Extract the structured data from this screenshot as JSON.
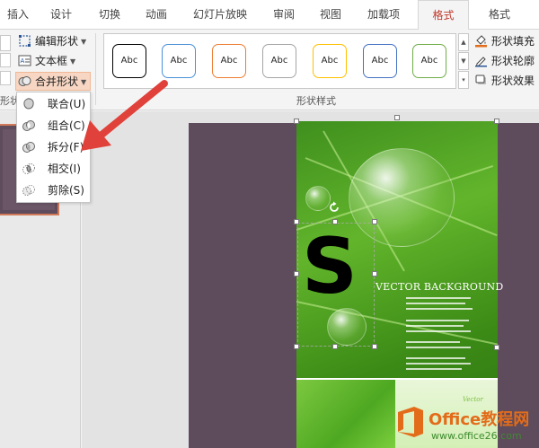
{
  "tabs": [
    {
      "label": "插入"
    },
    {
      "label": "设计"
    },
    {
      "label": "切换"
    },
    {
      "label": "动画"
    },
    {
      "label": "幻灯片放映"
    },
    {
      "label": "审阅"
    },
    {
      "label": "视图"
    },
    {
      "label": "加载项"
    },
    {
      "label": "格式",
      "active": true
    },
    {
      "label": "格式"
    }
  ],
  "ribbon": {
    "insert_shapes": {
      "edit_shape": "编辑形状",
      "text_box": "文本框",
      "merge_shapes": "合并形状",
      "group_label_partial": "形状"
    },
    "shape_styles": {
      "group_label": "形状样式",
      "swatch_text": "Abc",
      "swatch_colors": [
        "#000000",
        "#4a90d9",
        "#ed7d31",
        "#a5a5a5",
        "#ffc000",
        "#4472c4",
        "#70ad47"
      ]
    },
    "shape_format": {
      "fill": "形状填充",
      "outline": "形状轮廓",
      "effects": "形状效果"
    }
  },
  "merge_menu": [
    {
      "label": "联合(U)",
      "icon": "union-icon"
    },
    {
      "label": "组合(C)",
      "icon": "combine-icon"
    },
    {
      "label": "拆分(F)",
      "icon": "fragment-icon"
    },
    {
      "label": "相交(I)",
      "icon": "intersect-icon"
    },
    {
      "label": "剪除(S)",
      "icon": "subtract-icon"
    }
  ],
  "slide": {
    "shape_text": "S",
    "image_title": "VECTOR BACKGROUND",
    "image_small_caption": "Vector"
  },
  "watermark": {
    "title": "Office教程网",
    "url": "www.office26.com"
  },
  "colors": {
    "accent_tab": "#c0392b",
    "merge_highlight": "#f7d6c3",
    "arrow": "#e0413a",
    "slide_bg": "#5e4b5c"
  }
}
